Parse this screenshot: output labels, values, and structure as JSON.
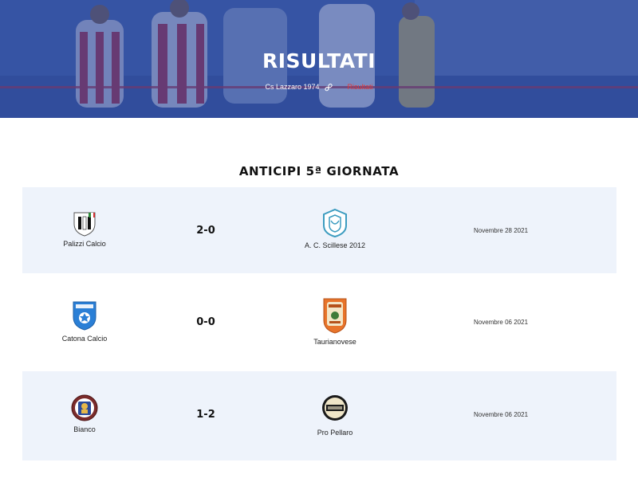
{
  "hero": {
    "title": "RISULTATI",
    "breadcrumb": {
      "home": "Cs Lazzaro 1974",
      "current": "Risultati"
    }
  },
  "section": {
    "title": "ANTICIPI 5ª GIORNATA"
  },
  "matches": [
    {
      "home": "Palizzi Calcio",
      "score": "2-0",
      "away": "A. C. Scillese 2012",
      "date": "Novembre 28 2021"
    },
    {
      "home": "Catona Calcio",
      "score": "0-0",
      "away": "Taurianovese",
      "date": "Novembre 06 2021"
    },
    {
      "home": "Bianco",
      "score": "1-2",
      "away": "Pro Pellaro",
      "date": "Novembre 06 2021"
    }
  ],
  "colors": {
    "accent_red": "#e03a3a",
    "hero_blue": "#2e4d99",
    "row_bg": "#eef3fb"
  }
}
